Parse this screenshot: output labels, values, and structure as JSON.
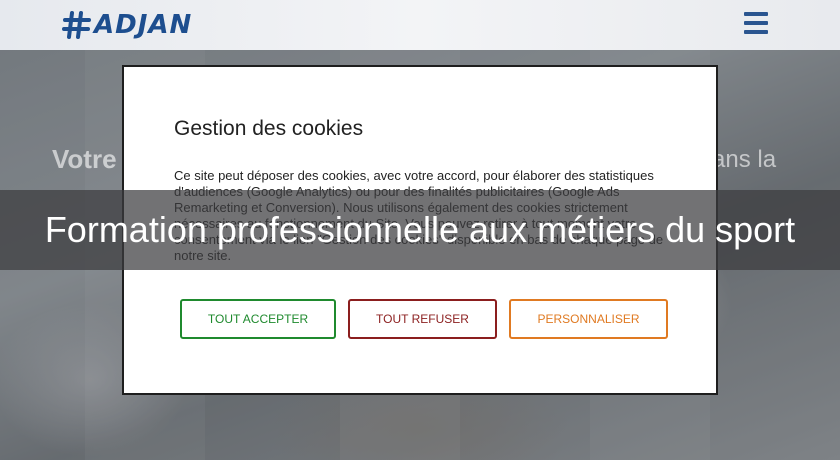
{
  "header": {
    "logo_text": "ADJAN",
    "menu_icon": "hamburger-icon"
  },
  "hero": {
    "text_left": "Votre",
    "text_right": "ans la"
  },
  "cookie_modal": {
    "title": "Gestion des cookies",
    "body": "Ce site peut déposer des cookies, avec votre accord, pour élaborer des statistiques d'audiences (Google Analytics) ou pour des finalités publicitaires (Google Ads Remarketing et Conversion). Nous utilisons également des cookies strictement nécessaires au fonctionnement du Site. Vous pouvez retirer à tout moment votre consentement via le lien \"Gestion des cookies\" disponible en bas de chaque page de notre site.",
    "accept_label": "TOUT ACCEPTER",
    "refuse_label": "TOUT REFUSER",
    "customize_label": "PERSONNALISER",
    "colors": {
      "accept": "#1f8a2e",
      "refuse": "#8b1e1e",
      "customize": "#e07a22"
    }
  },
  "banner": {
    "title": "Formation professionnelle aux métiers du sport"
  }
}
